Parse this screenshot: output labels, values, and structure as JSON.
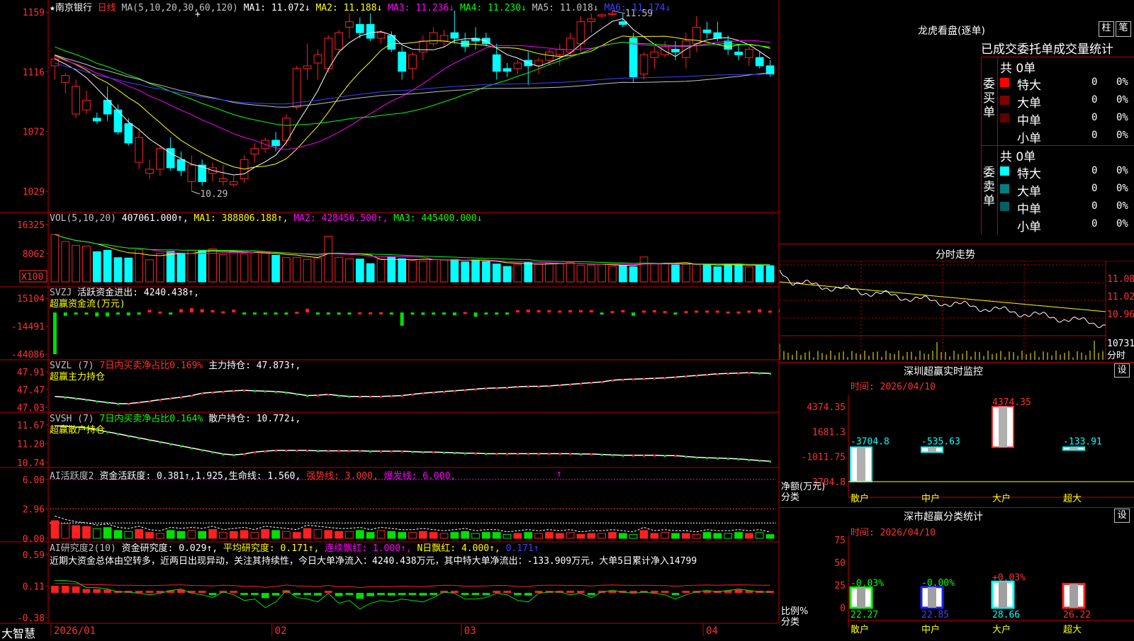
{
  "colors": {
    "up": "#ff2020",
    "down": "#00ffff",
    "ma1": "#ffffff",
    "ma2": "#ffff00",
    "ma3": "#ff00ff",
    "ma4": "#00ff00",
    "ma5": "#c0c0c0",
    "ma6": "#4040ff",
    "grid": "#c00000",
    "green": "#00e000"
  },
  "header": {
    "star": "★",
    "name": "南京银行",
    "period": "日线",
    "ma_params": "MA(5,10,20,30,60,120)",
    "ma_items": [
      {
        "label": "MA1: 11.072↓",
        "color": "#ffffff"
      },
      {
        "label": "MA2: 11.188↓",
        "color": "#ffff00"
      },
      {
        "label": "MA3: 11.236↓",
        "color": "#ff00ff"
      },
      {
        "label": "MA4: 11.230↓",
        "color": "#00ff00"
      },
      {
        "label": "MA5: 11.018↓",
        "color": "#c0c0c0"
      },
      {
        "label": "MA6: 11.174↓",
        "color": "#4040ff"
      }
    ]
  },
  "price_panel": {
    "y_labels": [
      "1159",
      "1116",
      "1072",
      "1029"
    ],
    "high_note": "11.59",
    "low_note": "10.29",
    "plus": "+"
  },
  "vol_panel": {
    "title": "VOL(5,10,20)",
    "value": "407061.000↑,",
    "items": [
      {
        "label": "MA1: 388806.188↑,",
        "color": "#ffff00"
      },
      {
        "label": "MA2: 428456.500↑,",
        "color": "#ff00ff"
      },
      {
        "label": "MA3: 445400.000↓",
        "color": "#00ff00"
      }
    ],
    "y_labels": [
      "16325",
      "8062"
    ],
    "unit": "X100"
  },
  "svzj_panel": {
    "title": "SVZJ",
    "label": "活跃资金进出: 4240.438↑,",
    "subtitle": "超赢资金流(万元)",
    "y_labels": [
      "15104",
      "-14491",
      "-44086"
    ]
  },
  "svzl_panel": {
    "title": "SVZL (7)",
    "ratio": "7日内买卖净占比0.169%",
    "hold": "主力持仓: 47.873↑,",
    "subtitle": "超赢主力持仓",
    "y_labels": [
      "47.91",
      "47.47",
      "47.03"
    ]
  },
  "svsh_panel": {
    "title": "SVSH (7)",
    "ratio": "7日内买卖净占比0.164%",
    "hold": "散户持仓: 10.772↓,",
    "subtitle": "超赢散户持仓",
    "y_labels": [
      "11.67",
      "11.20",
      "10.74"
    ]
  },
  "ai1_panel": {
    "title": "AI活跃度2",
    "label": "资金活跃度: 0.381↑,1.925,生命线: 1.560,",
    "strong": "强势线: 3.000,",
    "burst": "爆发线: 6.000,",
    "y_labels": [
      "6.00",
      "2.96",
      "0.00"
    ]
  },
  "ai2_panel": {
    "title": "AI研究度2(10)",
    "label": "资金研究度: 0.029↑,",
    "avg": "平均研究度: 0.171↑,",
    "streak": "连续飘红: 1.000↑,",
    "nday": "N日飘红: 4.000↑,",
    "last": "0.171↑",
    "comment": "近期大资金总体由空转多，近两日出现异动，关注其持续性，今日大单净流入：4240.438万元，其中特大单净流出：-133.909万元，大单5日累计净入14799",
    "y_labels": [
      "0.59",
      "0.11",
      "-0.38"
    ]
  },
  "x_axis": {
    "labels": [
      "2026/01",
      "02",
      "03",
      "04"
    ],
    "brand": "大智慧"
  },
  "dragon": {
    "title": "龙虎看盘(逐单)",
    "btn_zhu": "柱",
    "btn_bi": "笔",
    "header": "已成交委托单成交量统计",
    "buy": {
      "side": "委买单",
      "total": "共 0单",
      "rows": [
        {
          "label": "特大",
          "value": "0",
          "pct": "0%",
          "color": "#ff0000"
        },
        {
          "label": "大单",
          "value": "0",
          "pct": "0%",
          "color": "#800000"
        },
        {
          "label": "中单",
          "value": "0",
          "pct": "0%",
          "color": "#600000"
        },
        {
          "label": "小单",
          "value": "0",
          "pct": "0%",
          "color": "#000000"
        }
      ]
    },
    "sell": {
      "side": "委卖单",
      "total": "共 0单",
      "rows": [
        {
          "label": "特大",
          "value": "0",
          "pct": "0%",
          "color": "#00ffff"
        },
        {
          "label": "大单",
          "value": "0",
          "pct": "0%",
          "color": "#008080"
        },
        {
          "label": "中单",
          "value": "0",
          "pct": "0%",
          "color": "#006060"
        },
        {
          "label": "小单",
          "value": "0",
          "pct": "0%",
          "color": "#000000"
        }
      ]
    }
  },
  "intraday": {
    "title": "分时走势",
    "y_labels": [
      "11.08",
      "11.02",
      "10.96"
    ],
    "vol_label": "10731",
    "tag": "分时"
  },
  "sz_monitor": {
    "title": "深圳超赢实时监控",
    "set": "设",
    "time": "时间: 2026/04/10",
    "y_labels": [
      "4374.35",
      "1681.3",
      "-1011.75",
      "-3704.8"
    ],
    "axis_title": "净额(万元)",
    "axis_sub": "分类",
    "bars": [
      {
        "name": "散户",
        "value": -3704.8,
        "label": "-3704.8"
      },
      {
        "name": "中户",
        "value": -535.63,
        "label": "-535.63"
      },
      {
        "name": "大户",
        "value": 4374.35,
        "label": "4374.35"
      },
      {
        "name": "超大",
        "value": -133.91,
        "label": "-133.91"
      }
    ]
  },
  "sz_class": {
    "title": "深市超赢分类统计",
    "set": "设",
    "time": "时间: 2026/04/10",
    "y_labels": [
      "75",
      "50",
      "25",
      "0"
    ],
    "axis_title": "比例%",
    "axis_sub": "分类",
    "bars": [
      {
        "name": "散户",
        "value": 22.27,
        "label": "22.27",
        "change": "-0.03%",
        "color": "#00ff00"
      },
      {
        "name": "中户",
        "value": 22.85,
        "label": "22.85",
        "change": "-0.00%",
        "color": "#2020ff"
      },
      {
        "name": "大户",
        "value": 28.66,
        "label": "28.66",
        "change": "+0.03%",
        "color": "#00ffff"
      },
      {
        "name": "超大",
        "value": 26.22,
        "label": "26.22",
        "change": "",
        "color": "#ff2020"
      }
    ]
  },
  "chart_data": [
    {
      "type": "candlestick",
      "title": "南京银行 日线",
      "ylim": [
        10.29,
        11.59
      ],
      "candles": [
        [
          11.2,
          11.28,
          11.1,
          11.25
        ],
        [
          11.08,
          11.15,
          11.0,
          11.13
        ],
        [
          10.85,
          11.1,
          10.82,
          11.05
        ],
        [
          10.88,
          11.02,
          10.85,
          10.95
        ],
        [
          10.82,
          10.86,
          10.78,
          10.8
        ],
        [
          10.95,
          11.05,
          10.8,
          10.85
        ],
        [
          10.88,
          10.92,
          10.7,
          10.72
        ],
        [
          10.78,
          10.82,
          10.62,
          10.64
        ],
        [
          10.5,
          10.75,
          10.45,
          10.68
        ],
        [
          10.42,
          10.52,
          10.38,
          10.45
        ],
        [
          10.45,
          10.62,
          10.4,
          10.6
        ],
        [
          10.6,
          10.68,
          10.44,
          10.46
        ],
        [
          10.52,
          10.58,
          10.4,
          10.44
        ],
        [
          10.36,
          10.55,
          10.29,
          10.48
        ],
        [
          10.48,
          10.52,
          10.33,
          10.36
        ],
        [
          10.42,
          10.5,
          10.36,
          10.46
        ],
        [
          10.36,
          10.48,
          10.33,
          10.38
        ],
        [
          10.34,
          10.4,
          10.32,
          10.36
        ],
        [
          10.38,
          10.55,
          10.35,
          10.52
        ],
        [
          10.56,
          10.64,
          10.5,
          10.6
        ],
        [
          10.6,
          10.68,
          10.57,
          10.66
        ],
        [
          10.66,
          10.72,
          10.58,
          10.62
        ],
        [
          10.66,
          10.85,
          10.62,
          10.82
        ],
        [
          10.9,
          11.2,
          10.88,
          11.18
        ],
        [
          11.18,
          11.36,
          11.1,
          11.2
        ],
        [
          11.22,
          11.32,
          11.1,
          11.28
        ],
        [
          11.18,
          11.42,
          11.15,
          11.4
        ],
        [
          11.32,
          11.46,
          11.28,
          11.44
        ],
        [
          11.48,
          11.58,
          11.4,
          11.52
        ],
        [
          11.5,
          11.55,
          11.4,
          11.44
        ],
        [
          11.5,
          11.58,
          11.38,
          11.4
        ],
        [
          11.4,
          11.46,
          11.36,
          11.44
        ],
        [
          11.42,
          11.45,
          11.3,
          11.32
        ],
        [
          11.3,
          11.34,
          11.1,
          11.16
        ],
        [
          11.18,
          11.3,
          11.1,
          11.28
        ],
        [
          11.3,
          11.42,
          11.24,
          11.38
        ],
        [
          11.36,
          11.48,
          11.34,
          11.44
        ],
        [
          11.38,
          11.46,
          11.34,
          11.42
        ],
        [
          11.44,
          11.6,
          11.36,
          11.4
        ],
        [
          11.38,
          11.44,
          11.3,
          11.34
        ],
        [
          11.4,
          11.48,
          11.32,
          11.38
        ],
        [
          11.4,
          11.44,
          11.34,
          11.36
        ],
        [
          11.28,
          11.36,
          11.1,
          11.16
        ],
        [
          11.18,
          11.22,
          11.12,
          11.16
        ],
        [
          11.18,
          11.24,
          11.14,
          11.22
        ],
        [
          11.24,
          11.3,
          11.06,
          11.2
        ],
        [
          11.2,
          11.26,
          11.14,
          11.24
        ],
        [
          11.24,
          11.32,
          11.2,
          11.3
        ],
        [
          11.28,
          11.36,
          11.2,
          11.32
        ],
        [
          11.3,
          11.44,
          11.26,
          11.4
        ],
        [
          11.36,
          11.56,
          11.3,
          11.52
        ],
        [
          11.52,
          11.58,
          11.44,
          11.54
        ],
        [
          11.56,
          11.58,
          11.55,
          11.57
        ],
        [
          11.58,
          11.6,
          11.56,
          11.58
        ],
        [
          11.52,
          11.58,
          11.48,
          11.5
        ],
        [
          11.4,
          11.44,
          11.08,
          11.12
        ],
        [
          11.14,
          11.3,
          11.1,
          11.28
        ],
        [
          11.26,
          11.34,
          11.18,
          11.3
        ],
        [
          11.28,
          11.38,
          11.26,
          11.34
        ],
        [
          11.32,
          11.38,
          11.24,
          11.3
        ],
        [
          11.26,
          11.44,
          11.18,
          11.38
        ],
        [
          11.36,
          11.56,
          11.3,
          11.48
        ],
        [
          11.46,
          11.52,
          11.4,
          11.44
        ],
        [
          11.44,
          11.52,
          11.38,
          11.4
        ],
        [
          11.38,
          11.42,
          11.28,
          11.32
        ],
        [
          11.3,
          11.36,
          11.24,
          11.28
        ],
        [
          11.26,
          11.34,
          11.2,
          11.32
        ],
        [
          11.26,
          11.3,
          11.18,
          11.2
        ],
        [
          11.2,
          11.24,
          11.12,
          11.14
        ]
      ]
    },
    {
      "type": "bar",
      "title": "VOL(5,10,20)",
      "ylim": [
        0,
        16325
      ],
      "values": [
        13500,
        11500,
        10400,
        10200,
        8600,
        9000,
        6900,
        6800,
        9200,
        6300,
        8100,
        8700,
        8200,
        9000,
        8900,
        9400,
        7800,
        8500,
        8000,
        8400,
        8300,
        7600,
        6900,
        7000,
        6400,
        6800,
        13000,
        7000,
        6600,
        6500,
        5200,
        6500,
        7100,
        6600,
        6100,
        5900,
        6300,
        6300,
        6400,
        5700,
        6300,
        5800,
        5100,
        4400,
        5000,
        5600,
        5100,
        5300,
        5200,
        5500,
        4700,
        4800,
        5000,
        4500,
        4700,
        4300,
        7100,
        5200,
        5300,
        4800,
        5000,
        4900,
        5000,
        4300,
        5100,
        5100,
        4300,
        4800,
        4600
      ]
    },
    {
      "type": "bar",
      "title": "SVZJ 超赢资金流(万元)",
      "ylim": [
        -44086,
        15104
      ],
      "values": [
        -44086,
        -3500,
        -1500,
        -1000,
        -4200,
        -4200,
        -1800,
        -3000,
        -2000,
        2800,
        1000,
        -1000,
        3500,
        4500,
        3500,
        2500,
        1200,
        3000,
        -700,
        -1000,
        -2000,
        -1000,
        -1500,
        800,
        4000,
        -700,
        -1200,
        -2000,
        -500,
        200,
        200,
        300,
        -500,
        -14000,
        -500,
        -2500,
        -1800,
        -1000,
        -3000,
        500,
        -4500,
        -1000,
        -1000,
        -2000,
        2500,
        3000,
        2500,
        2500,
        2000,
        2500,
        2500,
        2500,
        -800,
        1500,
        2500,
        -3500,
        2000,
        2500,
        1500,
        -1600,
        1500,
        2000,
        2000,
        2000,
        1000,
        1000,
        2000,
        3500,
        2000,
        3000,
        4240
      ]
    },
    {
      "type": "line",
      "title": "SVZL 超赢主力持仓",
      "ylim": [
        47.03,
        47.91
      ],
      "values": [
        47.3,
        47.28,
        47.25,
        47.22,
        47.18,
        47.15,
        47.12,
        47.12,
        47.15,
        47.18,
        47.22,
        47.25,
        47.28,
        47.32,
        47.38,
        47.4,
        47.42,
        47.44,
        47.45,
        47.44,
        47.43,
        47.42,
        47.4,
        47.36,
        47.32,
        47.33,
        47.35,
        47.32,
        47.3,
        47.3,
        47.3,
        47.3,
        47.31,
        47.32,
        47.35,
        47.38,
        47.4,
        47.42,
        47.44,
        47.46,
        47.48,
        47.5,
        47.51,
        47.52,
        47.54,
        47.55,
        47.55,
        47.56,
        47.58,
        47.6,
        47.62,
        47.64,
        47.66,
        47.7,
        47.72,
        47.73,
        47.74,
        47.75,
        47.76,
        47.78,
        47.8,
        47.82,
        47.84,
        47.86,
        47.87,
        47.88,
        47.89,
        47.88,
        47.873
      ]
    },
    {
      "type": "line",
      "title": "SVSH 超赢散户持仓",
      "ylim": [
        10.74,
        11.67
      ],
      "values": [
        11.65,
        11.64,
        11.62,
        11.6,
        11.55,
        11.5,
        11.45,
        11.4,
        11.35,
        11.3,
        11.25,
        11.2,
        11.15,
        11.1,
        11.05,
        11.0,
        10.95,
        10.93,
        10.95,
        11.0,
        11.02,
        11.04,
        11.04,
        11.04,
        11.04,
        11.03,
        11.03,
        11.03,
        11.03,
        11.03,
        11.02,
        11.02,
        11.02,
        11.02,
        11.01,
        11.0,
        11.0,
        10.99,
        10.98,
        10.97,
        10.97,
        10.96,
        10.96,
        10.96,
        10.96,
        10.96,
        10.96,
        10.96,
        10.96,
        10.96,
        10.95,
        10.95,
        10.94,
        10.93,
        10.92,
        10.92,
        10.92,
        10.92,
        10.91,
        10.91,
        10.89,
        10.87,
        10.86,
        10.85,
        10.84,
        10.83,
        10.81,
        10.79,
        10.772
      ]
    },
    {
      "type": "bar",
      "title": "AI活跃度2 资金活跃度",
      "ylim": [
        0,
        6
      ],
      "values": [
        1.8,
        1.5,
        1.3,
        1.2,
        1.0,
        1.1,
        0.8,
        0.7,
        0.9,
        0.6,
        0.5,
        0.8,
        0.7,
        0.8,
        0.7,
        0.9,
        0.6,
        0.7,
        0.8,
        0.6,
        0.9,
        0.8,
        0.7,
        0.6,
        1.0,
        0.9,
        0.8,
        0.7,
        0.7,
        0.8,
        0.6,
        0.8,
        0.7,
        0.6,
        0.6,
        0.7,
        0.6,
        0.5,
        0.6,
        0.7,
        0.5,
        0.6,
        0.6,
        0.4,
        0.5,
        0.6,
        0.5,
        0.6,
        0.5,
        0.6,
        0.4,
        0.5,
        0.5,
        0.6,
        0.5,
        0.4,
        0.8,
        0.5,
        0.6,
        0.5,
        0.5,
        0.4,
        0.6,
        0.5,
        0.5,
        0.6,
        0.5,
        0.6,
        0.381
      ]
    },
    {
      "type": "bar",
      "title": "AI研究度2(10)",
      "ylim": [
        -0.38,
        0.59
      ],
      "values": [
        0.11,
        0.11,
        0.1,
        0.06,
        0.06,
        0.05,
        0.03,
        0.03,
        0.02,
        0.01,
        0.02,
        0.04,
        0.05,
        0.02,
        0.01,
        -0.01,
        0.03,
        0.01,
        -0.03,
        -0.02,
        -0.08,
        -0.04,
        0.04,
        -0.01,
        -0.02,
        -0.04,
        0.02,
        -0.05,
        -0.03,
        -0.09,
        -0.05,
        -0.03,
        -0.04,
        -0.02,
        -0.03,
        -0.04,
        -0.01,
        0.03,
        0.02,
        -0.02,
        -0.02,
        -0.01,
        0.02,
        0.01,
        -0.03,
        -0.04,
        0.02,
        0.03,
        0.03,
        0.01,
        0.02,
        -0.01,
        0.03,
        0.04,
        0.03,
        0.02,
        0.03,
        0.02,
        0.01,
        -0.02,
        0.01,
        0.03,
        0.04,
        0.03,
        0.04,
        0.05,
        0.04,
        0.03,
        0.029
      ]
    },
    {
      "type": "bar",
      "title": "深圳超赢实时监控",
      "categories": [
        "散户",
        "中户",
        "大户",
        "超大"
      ],
      "values": [
        -3704.8,
        -535.63,
        4374.35,
        -133.91
      ],
      "ylabel": "净额(万元)",
      "xlabel": "分类",
      "ylim": [
        -3704.8,
        4374.35
      ]
    },
    {
      "type": "bar",
      "title": "深市超赢分类统计",
      "categories": [
        "散户",
        "中户",
        "大户",
        "超大"
      ],
      "values": [
        22.27,
        22.85,
        28.66,
        26.22
      ],
      "ylabel": "比例%",
      "xlabel": "分类",
      "ylim": [
        0,
        75
      ]
    }
  ]
}
